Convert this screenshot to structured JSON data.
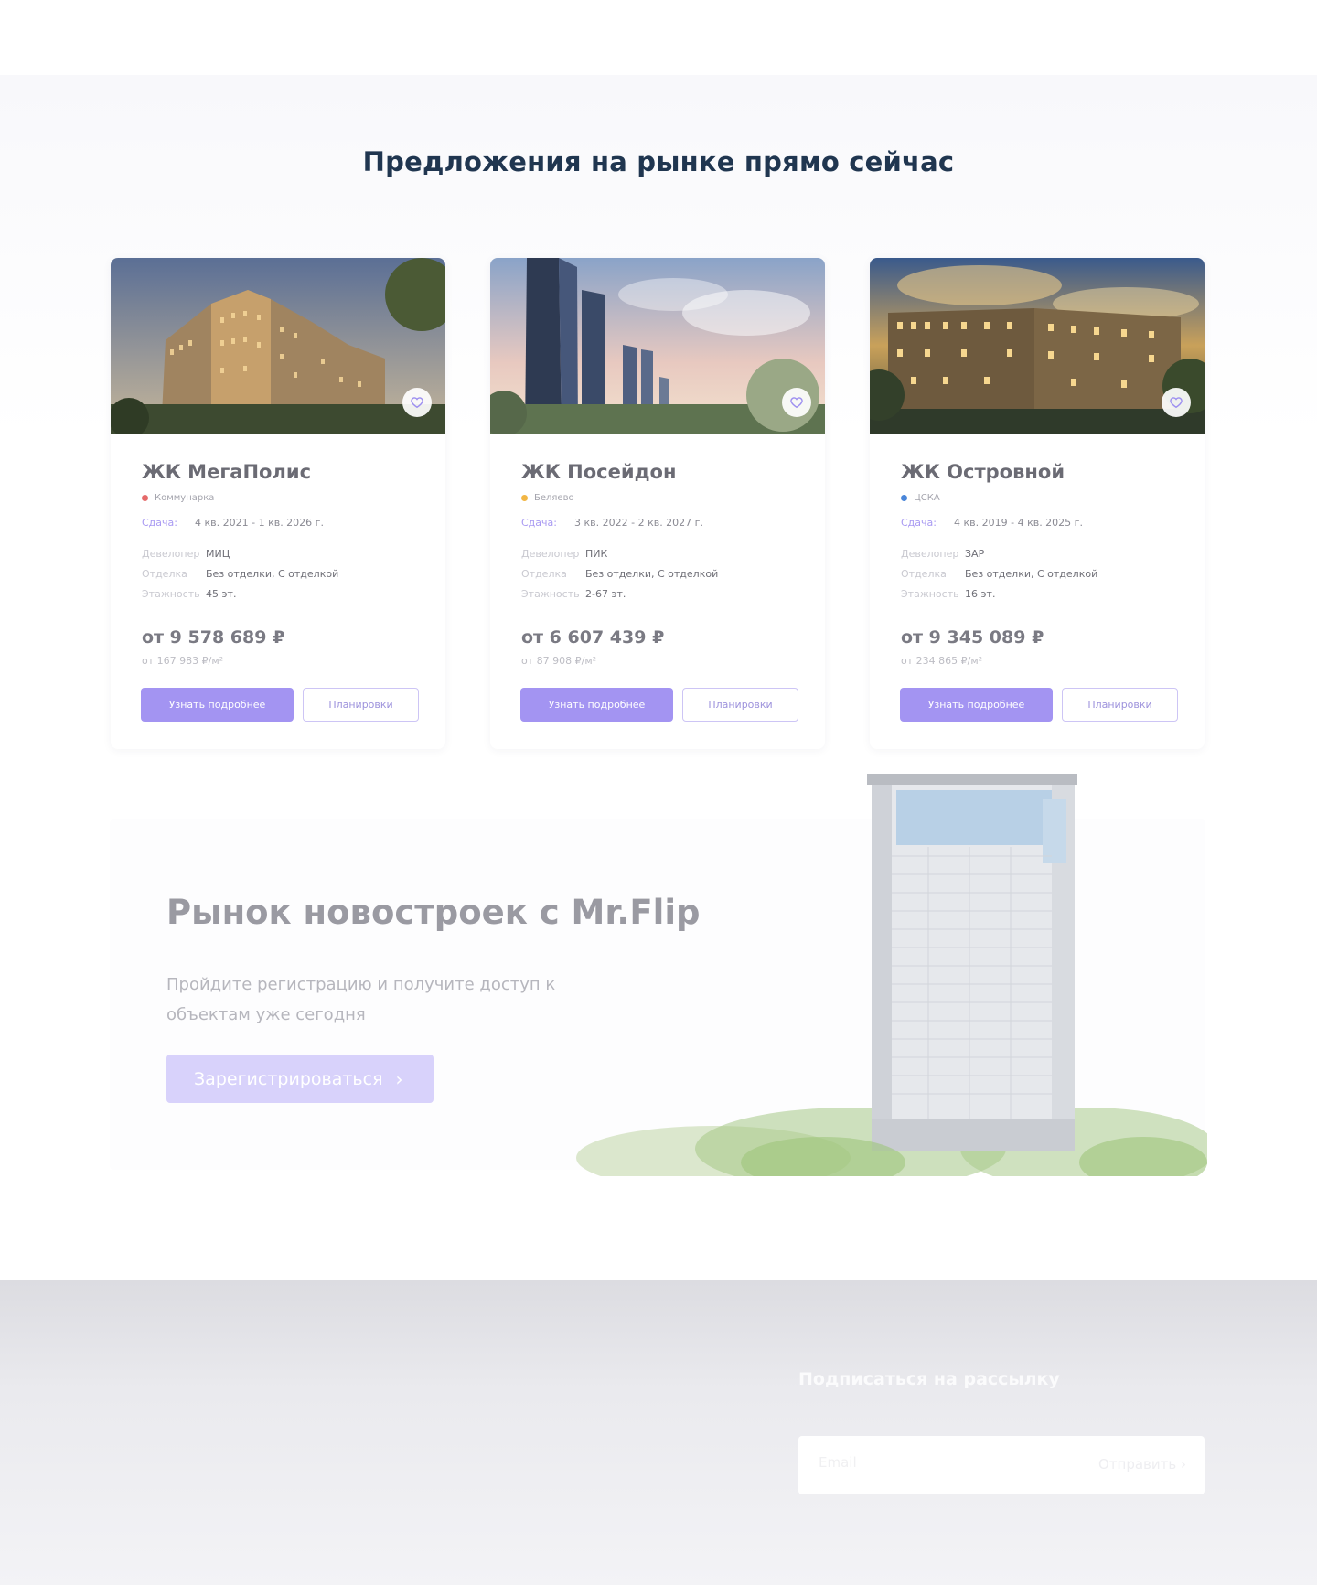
{
  "section": {
    "title": "Предложения на рынке прямо сейчас"
  },
  "cards": [
    {
      "name": "ЖК МегаПолис",
      "metro": "Коммунарка",
      "metro_color": "#e56a6a",
      "delivery_label": "Сдача:",
      "delivery": "4 кв. 2021 - 1 кв. 2026 г.",
      "props": [
        {
          "k": "Девелопер",
          "v": "МИЦ"
        },
        {
          "k": "Отделка",
          "v": "Без отделки, С отделкой"
        },
        {
          "k": "Этажность",
          "v": "45 эт."
        }
      ],
      "price": "от 9 578 689 ₽",
      "price_sqm": "от 167 983 ₽/м²",
      "btn_more": "Узнать подробнее",
      "btn_plans": "Планировки"
    },
    {
      "name": "ЖК Посейдон",
      "metro": "Беляево",
      "metro_color": "#f2b644",
      "delivery_label": "Сдача:",
      "delivery": "3 кв. 2022 - 2 кв. 2027 г.",
      "props": [
        {
          "k": "Девелопер",
          "v": "ПИК"
        },
        {
          "k": "Отделка",
          "v": "Без отделки, С отделкой"
        },
        {
          "k": "Этажность",
          "v": "2-67 эт."
        }
      ],
      "price": "от 6 607 439 ₽",
      "price_sqm": "от 87 908 ₽/м²",
      "btn_more": "Узнать подробнее",
      "btn_plans": "Планировки"
    },
    {
      "name": "ЖК Островной",
      "metro": "ЦСКА",
      "metro_color": "#4a86d9",
      "delivery_label": "Сдача:",
      "delivery": "4 кв. 2019 - 4 кв. 2025 г.",
      "props": [
        {
          "k": "Девелопер",
          "v": "ЗАР"
        },
        {
          "k": "Отделка",
          "v": "Без отделки, С отделкой"
        },
        {
          "k": "Этажность",
          "v": "16 эт."
        }
      ],
      "price": "от 9 345 089 ₽",
      "price_sqm": "от 234 865 ₽/м²",
      "btn_more": "Узнать подробнее",
      "btn_plans": "Планировки"
    }
  ],
  "cta": {
    "title": "Рынок новостроек с Mr.Flip",
    "subtitle": "Пройдите регистрацию и получите доступ к объектам уже сегодня",
    "button": "Зарегистрироваться",
    "button_icon": "chevron-right-icon"
  },
  "footer": {
    "subscribe_label": "Подписаться на рассылку",
    "email_placeholder": "Email",
    "send_label": "Отправить",
    "send_icon": "chevron-right-icon"
  },
  "colors": {
    "accent": "#a394f2",
    "title": "#203650"
  }
}
